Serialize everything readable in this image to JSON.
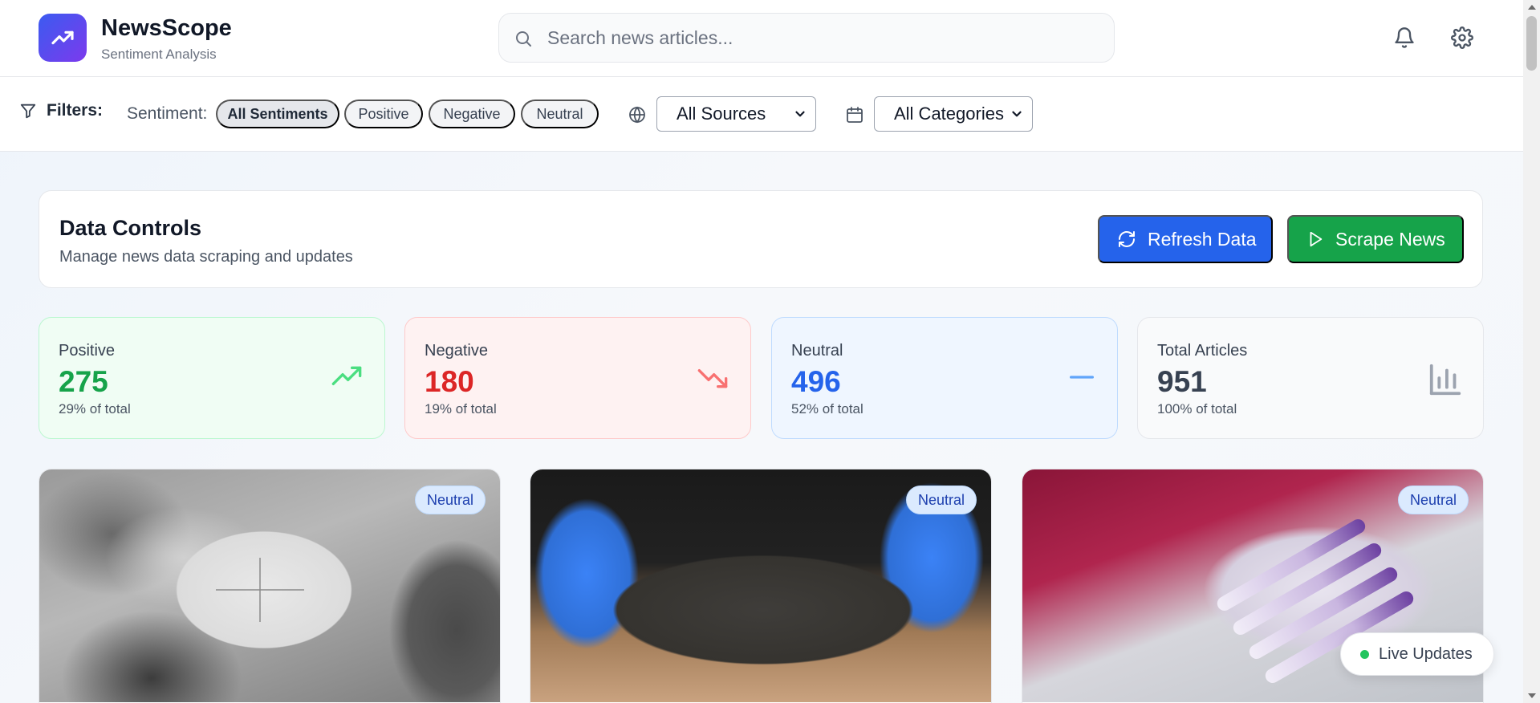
{
  "app": {
    "title": "NewsScope",
    "subtitle": "Sentiment Analysis"
  },
  "search": {
    "placeholder": "Search news articles..."
  },
  "header_icons": [
    "bell-icon",
    "gear-icon"
  ],
  "filters": {
    "label": "Filters:",
    "sentiment_label": "Sentiment:",
    "sentiment_options": [
      "All Sentiments",
      "Positive",
      "Negative",
      "Neutral"
    ],
    "selected_sentiment": "All Sentiments",
    "source_select": "All Sources",
    "category_select": "All Categories"
  },
  "controls": {
    "title": "Data Controls",
    "subtitle": "Manage news data scraping and updates",
    "refresh_label": "Refresh Data",
    "scrape_label": "Scrape News"
  },
  "stats": [
    {
      "title": "Positive",
      "value": "275",
      "pct": "29% of total",
      "icon": "trending-up-icon"
    },
    {
      "title": "Negative",
      "value": "180",
      "pct": "19% of total",
      "icon": "trending-down-icon"
    },
    {
      "title": "Neutral",
      "value": "496",
      "pct": "52% of total",
      "icon": "minus-icon"
    },
    {
      "title": "Total Articles",
      "value": "951",
      "pct": "100% of total",
      "icon": "bar-chart-icon"
    }
  ],
  "articles": [
    {
      "badge": "Neutral"
    },
    {
      "badge": "Neutral"
    },
    {
      "badge": "Neutral"
    }
  ],
  "live": {
    "label": "Live Updates"
  },
  "colors": {
    "primary": "#2563eb",
    "success": "#16a34a",
    "danger": "#dc2626",
    "brand_gradient_start": "#3b5bf0",
    "brand_gradient_end": "#7c3aed"
  }
}
